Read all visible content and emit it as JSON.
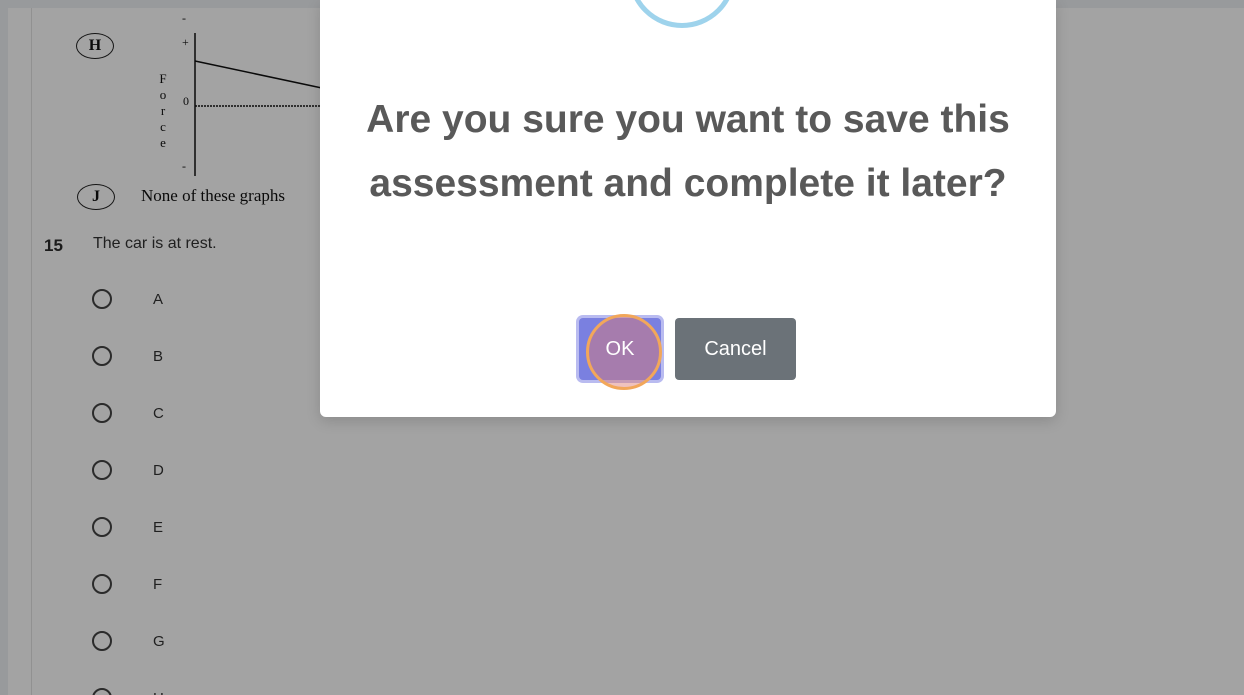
{
  "question_area": {
    "graph_option_letter": "H",
    "force_axis_letters": [
      "F",
      "o",
      "r",
      "c",
      "e"
    ],
    "plus_tick": "+",
    "zero_tick": "0",
    "minus_tick": "-",
    "top_minus_tick": "-",
    "option_j_letter": "J",
    "option_j_text": "None of these graphs"
  },
  "question": {
    "number": "15",
    "text": "The car is at rest.",
    "options": [
      "A",
      "B",
      "C",
      "D",
      "E",
      "F",
      "G",
      "H"
    ]
  },
  "dialog": {
    "message": "Are you sure you want to save this assessment and complete it later?",
    "ok_label": "OK",
    "cancel_label": "Cancel"
  },
  "colors": {
    "overlay": "rgba(0,0,0,0.36)",
    "ok_button": "#7a80e0",
    "cancel_button": "#6b7278",
    "icon_ring": "#9ed3ec",
    "click_indicator": "#f2a75a"
  }
}
